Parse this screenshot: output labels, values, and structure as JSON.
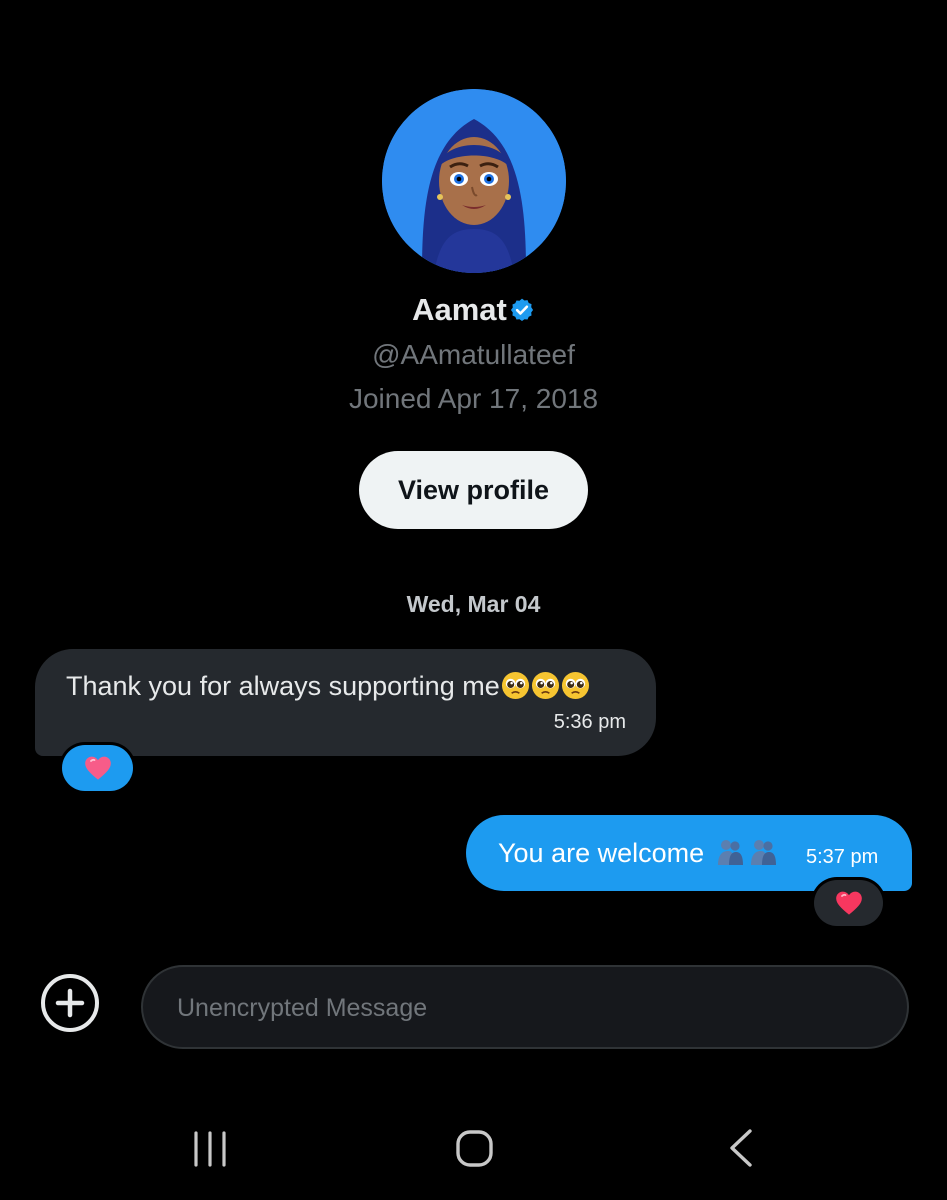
{
  "profile": {
    "name": "Aamat",
    "handle": "@AAmatullateef",
    "joined": "Joined Apr 17, 2018",
    "view_profile_label": "View profile",
    "avatar_icon": "avatar-hijab-cartoon-icon",
    "verified_icon": "verified-badge-icon"
  },
  "conversation": {
    "date_separator": "Wed, Mar 04",
    "messages": [
      {
        "direction": "incoming",
        "text": "Thank you for always supporting me",
        "emoji": [
          "pleading-face-icon",
          "pleading-face-icon",
          "pleading-face-icon"
        ],
        "time": "5:36 pm",
        "reaction": "heart-icon"
      },
      {
        "direction": "outgoing",
        "text": "You are welcome ",
        "emoji": [
          "people-hugging-icon",
          "people-hugging-icon"
        ],
        "time": "5:37 pm",
        "reaction": "heart-icon"
      }
    ]
  },
  "composer": {
    "placeholder": "Unencrypted Message",
    "value": "",
    "add_icon": "plus-circle-icon"
  },
  "navbar": {
    "recents_icon": "recent-apps-icon",
    "home_icon": "home-icon",
    "back_icon": "back-icon"
  },
  "colors": {
    "background": "#000000",
    "accent": "#1d9bf0",
    "incoming_bubble": "#25292e",
    "muted_text": "#71767b",
    "heart": "#f91880"
  }
}
